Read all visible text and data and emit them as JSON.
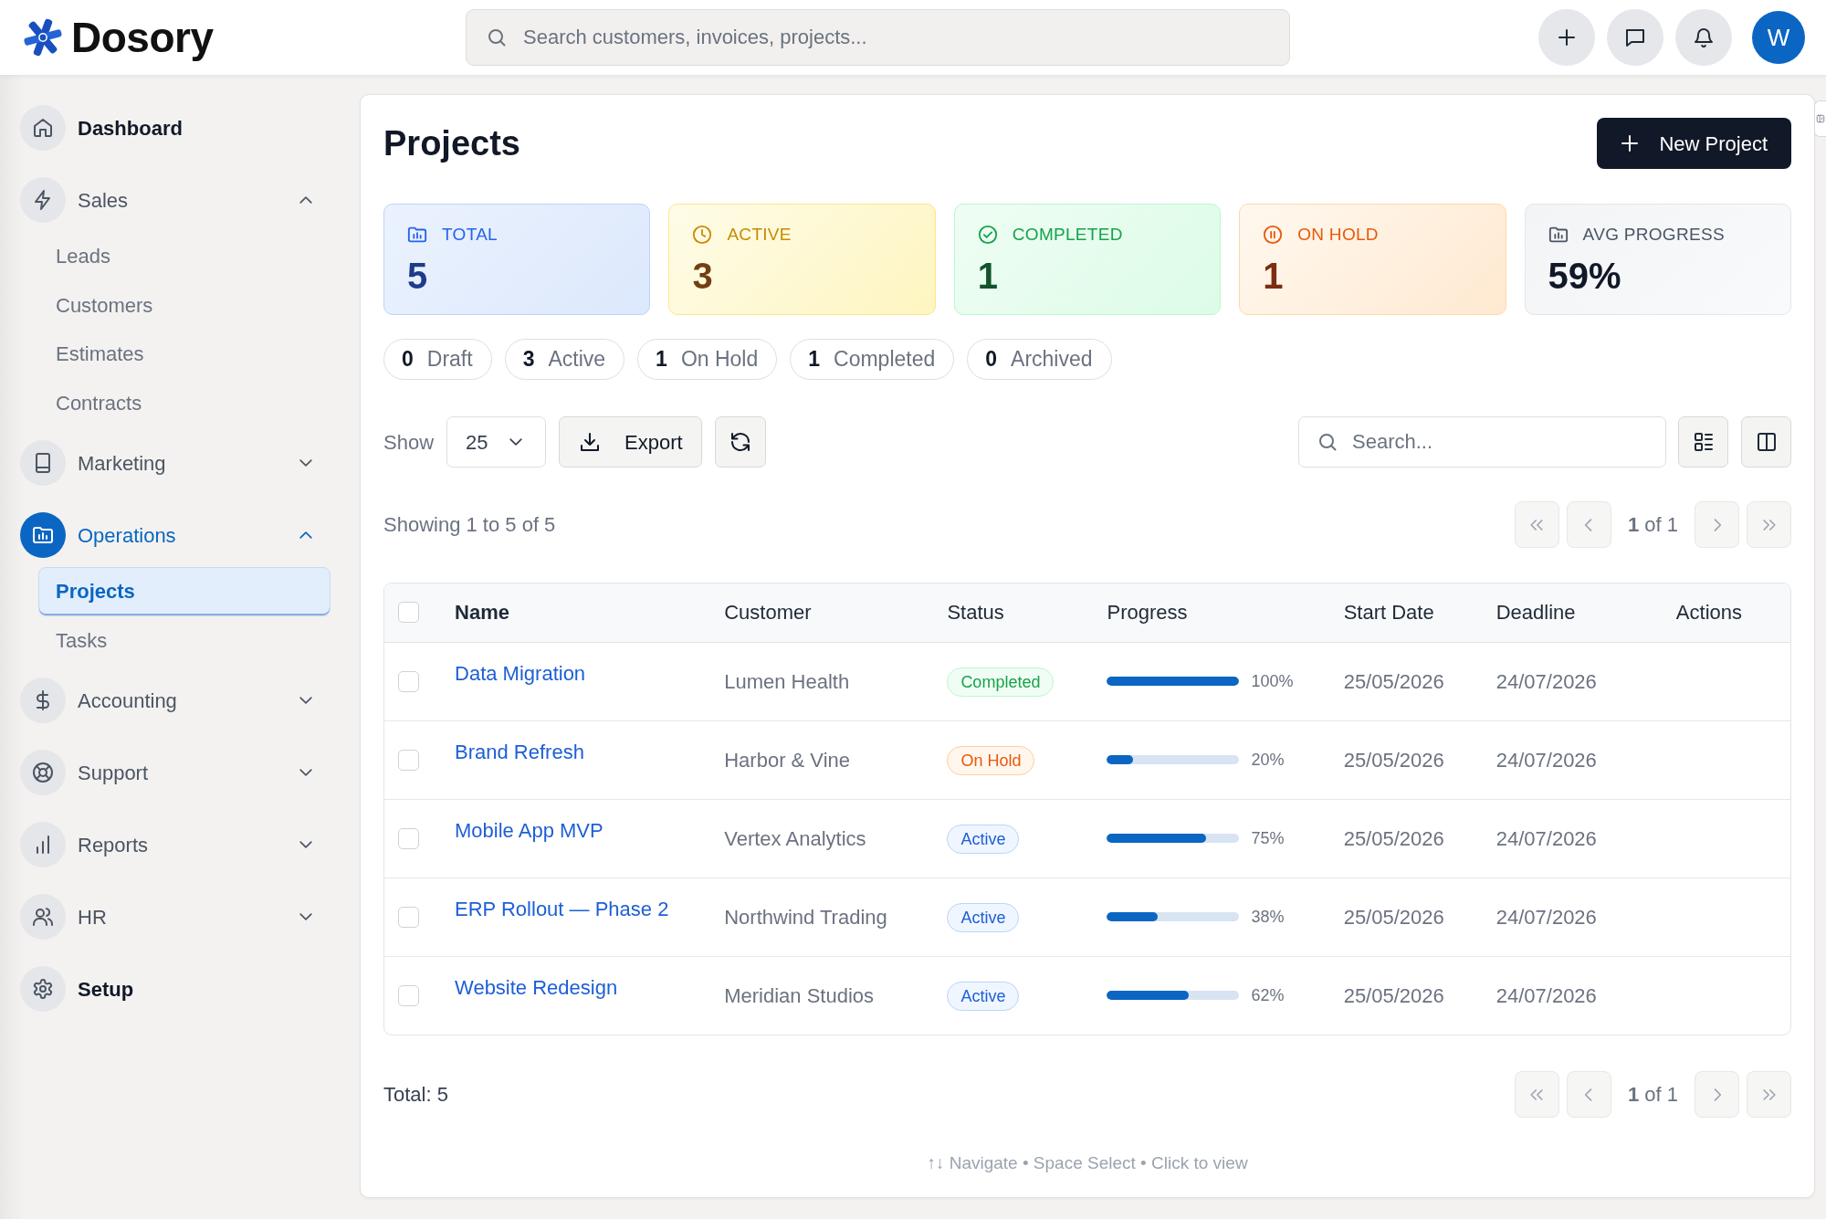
{
  "header": {
    "logo_text": "Dosory",
    "search": {
      "placeholder": "Search customers, invoices, projects..."
    },
    "avatar": "W"
  },
  "sidebar": {
    "items": [
      {
        "kind": "link",
        "label": "Dashboard",
        "selected": false
      },
      {
        "kind": "group",
        "label": "Sales",
        "selected": false,
        "expanded": true,
        "children": [
          {
            "label": "Leads",
            "selected": false
          },
          {
            "label": "Customers",
            "selected": false
          },
          {
            "label": "Estimates",
            "selected": false
          },
          {
            "label": "Contracts",
            "selected": false
          }
        ]
      },
      {
        "kind": "group",
        "label": "Marketing",
        "selected": false,
        "expanded": false
      },
      {
        "kind": "group",
        "label": "Operations",
        "selected": true,
        "expanded": true,
        "children": [
          {
            "label": "Projects",
            "selected": true
          },
          {
            "label": "Tasks",
            "selected": false
          }
        ]
      },
      {
        "kind": "group",
        "label": "Accounting",
        "selected": false,
        "expanded": false
      },
      {
        "kind": "group",
        "label": "Support",
        "selected": false,
        "expanded": false
      },
      {
        "kind": "group",
        "label": "Reports",
        "selected": false,
        "expanded": false
      },
      {
        "kind": "group",
        "label": "HR",
        "selected": false,
        "expanded": false
      },
      {
        "kind": "link",
        "label": "Setup",
        "selected": false
      }
    ]
  },
  "page": {
    "title": "Projects",
    "primary_action": "New Project"
  },
  "stats": [
    {
      "kind": "total",
      "label": "TOTAL",
      "value": "5"
    },
    {
      "kind": "active",
      "label": "ACTIVE",
      "value": "3"
    },
    {
      "kind": "completed",
      "label": "COMPLETED",
      "value": "1"
    },
    {
      "kind": "on_hold",
      "label": "ON HOLD",
      "value": "1"
    },
    {
      "kind": "average",
      "label": "AVG PROGRESS",
      "value": "59%"
    }
  ],
  "filters": [
    {
      "count": "0",
      "label": "Draft",
      "selected": false
    },
    {
      "count": "3",
      "label": "Active",
      "selected": false
    },
    {
      "count": "1",
      "label": "On Hold",
      "selected": false
    },
    {
      "count": "1",
      "label": "Completed",
      "selected": false
    },
    {
      "count": "0",
      "label": "Archived",
      "selected": false
    }
  ],
  "toolbar": {
    "show_label": "Show",
    "page_size": "25",
    "export": "Export",
    "search": {
      "placeholder": "Search..."
    }
  },
  "summary": "Showing 1 to 5 of 5",
  "pagination_top": {
    "label": "**1** of 1",
    "disabled": true
  },
  "table": {
    "all_selected": false,
    "columns": [
      {
        "label": "Name",
        "sorted": true
      },
      {
        "label": "Customer",
        "sorted": false
      },
      {
        "label": "Status",
        "sorted": false
      },
      {
        "label": "Progress",
        "sorted": false
      },
      {
        "label": "Start Date",
        "sorted": false
      },
      {
        "label": "Deadline",
        "sorted": false
      },
      {
        "label": "Actions",
        "sorted": false
      }
    ],
    "rows": [
      {
        "selected": false,
        "name": "Data Migration",
        "customer": "Lumen Health",
        "status": {
          "label": "Completed",
          "kind": "completed"
        },
        "progress": {
          "level": 1.0,
          "reading": "100%"
        },
        "start_date": "25/05/2026",
        "deadline": "24/07/2026"
      },
      {
        "selected": false,
        "name": "Brand Refresh",
        "customer": "Harbor & Vine",
        "status": {
          "label": "On Hold",
          "kind": "on_hold"
        },
        "progress": {
          "level": 0.2,
          "reading": "20%"
        },
        "start_date": "25/05/2026",
        "deadline": "24/07/2026"
      },
      {
        "selected": false,
        "name": "Mobile App MVP",
        "customer": "Vertex Analytics",
        "status": {
          "label": "Active",
          "kind": "active"
        },
        "progress": {
          "level": 0.75,
          "reading": "75%"
        },
        "start_date": "25/05/2026",
        "deadline": "24/07/2026"
      },
      {
        "selected": false,
        "name": "ERP Rollout — Phase 2",
        "customer": "Northwind Trading",
        "status": {
          "label": "Active",
          "kind": "active"
        },
        "progress": {
          "level": 0.38,
          "reading": "38%"
        },
        "start_date": "25/05/2026",
        "deadline": "24/07/2026"
      },
      {
        "selected": false,
        "name": "Website Redesign",
        "customer": "Meridian Studios",
        "status": {
          "label": "Active",
          "kind": "active"
        },
        "progress": {
          "level": 0.62,
          "reading": "62%"
        },
        "start_date": "25/05/2026",
        "deadline": "24/07/2026"
      }
    ]
  },
  "footer": {
    "total": "Total: 5",
    "pagination": {
      "label": "**1** of 1",
      "disabled": true
    },
    "hint": "↑↓ Navigate • Space Select • Click to view"
  }
}
